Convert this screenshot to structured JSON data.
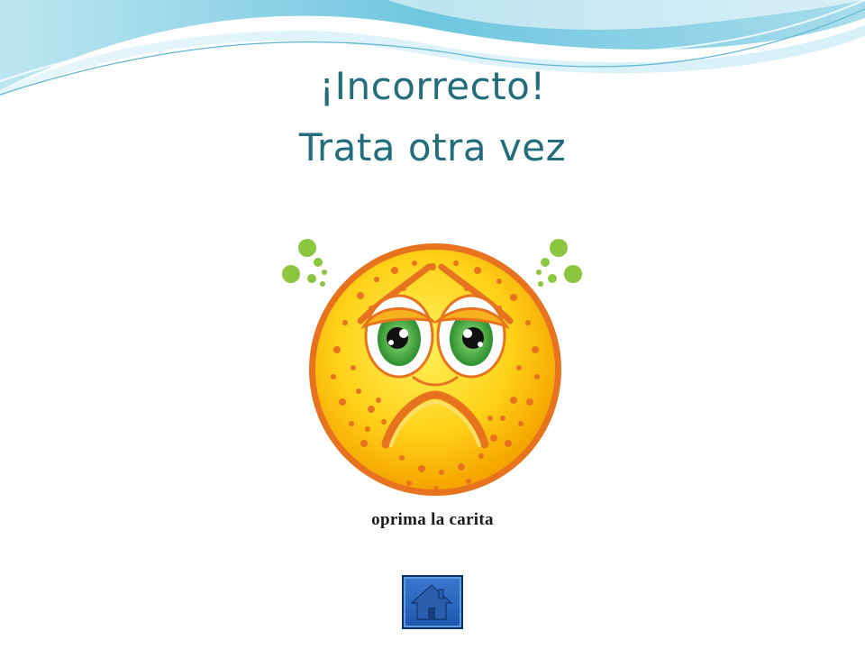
{
  "slide": {
    "title_line1": "¡Incorrecto!",
    "title_line2": "Trata otra vez",
    "caption": "oprima la carita",
    "title_color": "#216D7C"
  },
  "face": {
    "icon": "sad-face-icon",
    "face_color": "#F9C300",
    "freckle_color": "#E8731F",
    "eye_color": "#3A9E3A",
    "stink_color": "#8CC63F"
  },
  "home_button": {
    "icon": "home-icon",
    "color": "#2D68C4"
  }
}
